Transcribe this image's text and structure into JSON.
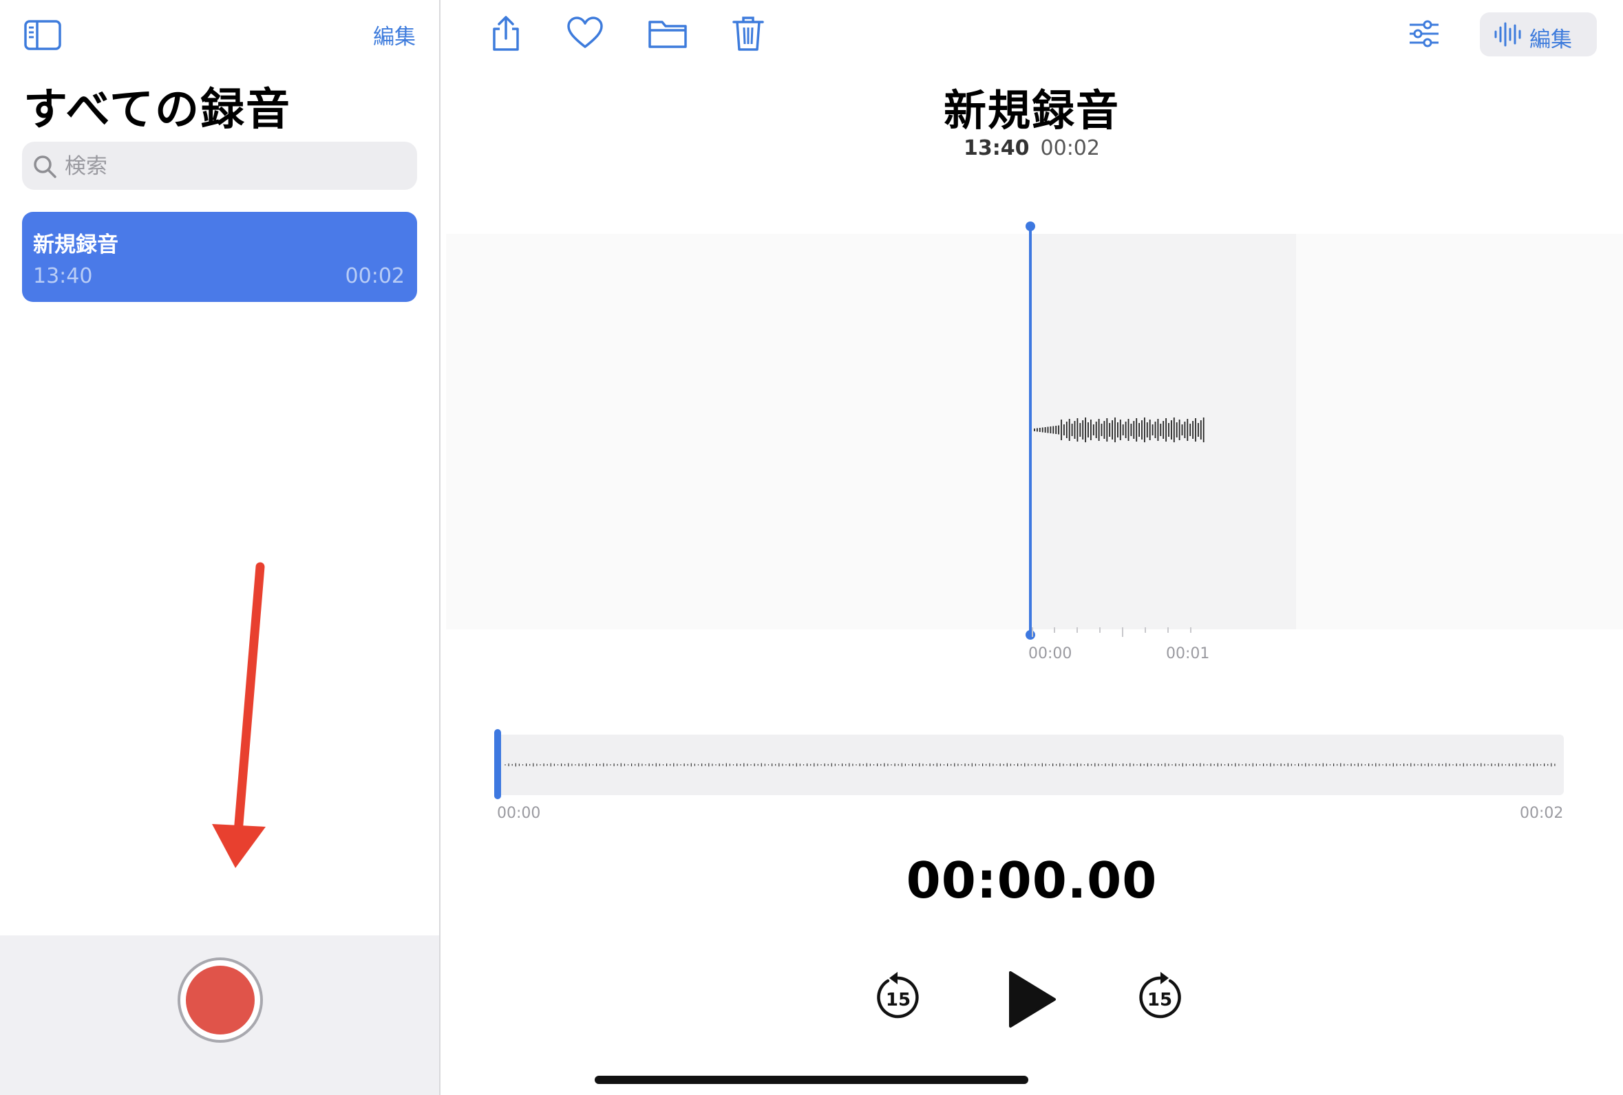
{
  "sidebar": {
    "edit_label": "編集",
    "title": "すべての録音",
    "search_placeholder": "検索",
    "recordings": [
      {
        "name": "新規録音",
        "time": "13:40",
        "duration": "00:02",
        "selected": true
      }
    ]
  },
  "toolbar": {
    "icons": [
      "share-icon",
      "heart-icon",
      "folder-icon",
      "trash-icon",
      "sliders-icon"
    ],
    "edit_label": "編集"
  },
  "detail": {
    "title": "新規録音",
    "time": "13:40",
    "duration": "00:02",
    "waveform_ticks": [
      "00:00",
      "00:01"
    ],
    "overview_start": "00:00",
    "overview_end": "00:02",
    "timer": "00:00.00",
    "controls": {
      "skip_back_label": "15",
      "skip_forward_label": "15"
    }
  },
  "colors": {
    "accent": "#3d7bdc",
    "selected_row": "#4a7ae8",
    "record": "#e0544a",
    "annotation_arrow": "#e8402f"
  }
}
